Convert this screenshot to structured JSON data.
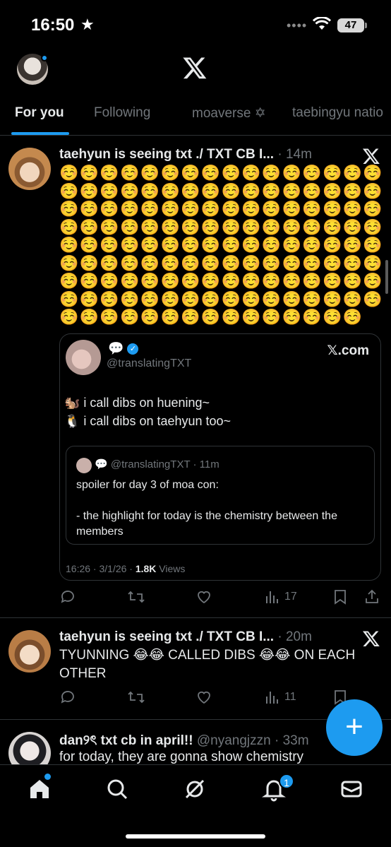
{
  "status_bar": {
    "time": "16:50",
    "battery": "47"
  },
  "tabs": [
    {
      "label": "For you",
      "active": true
    },
    {
      "label": "Following",
      "active": false
    },
    {
      "label": "moaverse ✡",
      "active": false
    },
    {
      "label": "taebingyu natio",
      "active": false
    }
  ],
  "posts": [
    {
      "name": "taehyun is seeing txt ./ TXT CB I...",
      "meta": "· 14m",
      "emoji_text": "☺️☺️☺️☺️☺️☺️☺️☺️☺️☺️☺️☺️☺️☺️☺️☺️☺️☺️☺️☺️☺️☺️☺️☺️☺️☺️☺️☺️☺️☺️☺️☺️☺️☺️☺️☺️☺️☺️☺️☺️☺️☺️☺️☺️☺️☺️☺️☺️☺️☺️☺️☺️☺️☺️☺️☺️☺️☺️☺️☺️☺️☺️☺️☺️☺️☺️☺️☺️☺️☺️☺️☺️☺️☺️☺️☺️☺️☺️☺️☺️☺️☺️☺️☺️☺️☺️☺️☺️☺️☺️☺️☺️☺️☺️☺️☺️☺️☺️☺️☺️☺️☺️☺️☺️☺️☺️☺️☺️☺️☺️☺️☺️☺️☺️☺️☺️☺️☺️☺️☺️☺️☺️☺️☺️☺️☺️☺️☺️☺️☺️☺️☺️☺️☺️☺️☺️☺️☺️☺️☺️☺️☺️☺️",
      "quote": {
        "line1": "💬",
        "handle": "@translatingTXT",
        "source": "𝕏.com",
        "body_line1": "🐿️ i call dibs on huening~",
        "body_line2": "🐧 i call dibs on taehyun too~",
        "inner_head": "💬 @translatingTXT · 11m",
        "inner_body_1": "spoiler for day 3 of moa con:",
        "inner_body_2": "- the highlight for today is the chemistry between the members",
        "footer_time": "16:26 · 3/1/26 · ",
        "footer_views": "1.8K",
        "footer_views_label": " Views"
      },
      "views_count": "17"
    },
    {
      "name": "taehyun is seeing txt ./ TXT CB I...",
      "meta": "· 20m",
      "text": "TYUNNING 😂😂 CALLED DIBS 😂😂 ON EACH OTHER",
      "views_count": "11"
    },
    {
      "name": "dan୨ৎ txt cb in april!!",
      "meta": "@nyangjzzn · 33m",
      "text": "for today, they are gonna show chemistry"
    }
  ],
  "bottom_nav": {
    "notifications_badge": "1"
  },
  "colors": {
    "accent": "#1d9bf0",
    "background": "#000000",
    "secondary_text": "#71767b",
    "divider": "#2f3336"
  },
  "icons": [
    "star-icon",
    "wifi-icon",
    "x-logo-icon",
    "reply-icon",
    "repost-icon",
    "like-icon",
    "views-icon",
    "bookmark-icon",
    "share-icon",
    "compose-icon",
    "home-icon",
    "search-icon",
    "grok-icon",
    "bell-icon",
    "mail-icon"
  ]
}
